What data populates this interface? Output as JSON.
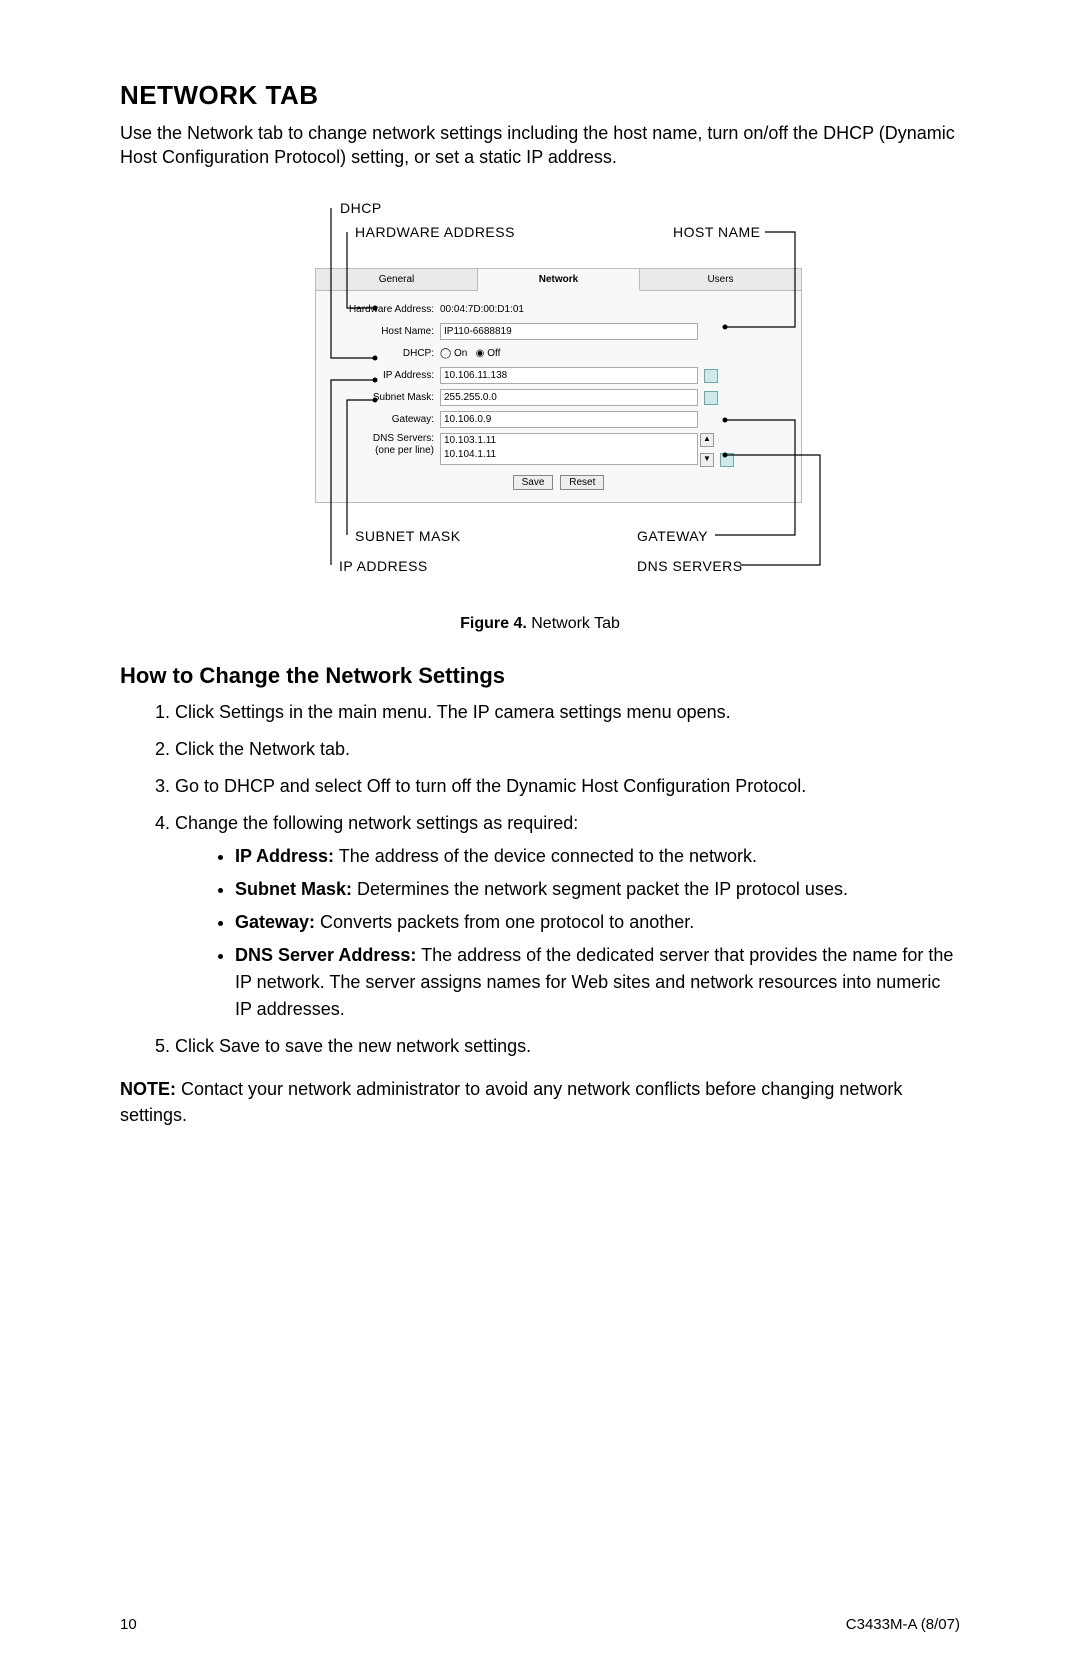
{
  "title": "NETWORK TAB",
  "intro": "Use the Network tab to change network settings including the host name, turn on/off the DHCP (Dynamic Host Configuration Protocol) setting, or set a static IP address.",
  "callouts": {
    "dhcp": "DHCP",
    "hardware_address": "HARDWARE ADDRESS",
    "host_name": "HOST NAME",
    "subnet_mask": "SUBNET MASK",
    "gateway": "GATEWAY",
    "ip_address": "IP ADDRESS",
    "dns_servers": "DNS SERVERS"
  },
  "panel": {
    "tabs": {
      "general": "General",
      "network": "Network",
      "users": "Users"
    },
    "labels": {
      "hw": "Hardware Address:",
      "host": "Host Name:",
      "dhcp": "DHCP:",
      "ip": "IP Address:",
      "subnet": "Subnet Mask:",
      "gateway": "Gateway:",
      "dns1": "DNS Servers:",
      "dns2": "(one per line)"
    },
    "values": {
      "hw": "00:04:7D:00:D1:01",
      "host": "IP110-6688819",
      "ip": "10.106.11.138",
      "subnet": "255.255.0.0",
      "gateway": "10.106.0.9",
      "dns": "10.103.1.11\n10.104.1.11"
    },
    "radio": {
      "on": "On",
      "off": "Off"
    },
    "buttons": {
      "save": "Save",
      "reset": "Reset"
    }
  },
  "figcap_bold": "Figure 4.",
  "figcap_rest": "  Network Tab",
  "subheading": "How to Change the Network Settings",
  "steps": {
    "s1": "Click Settings in the main menu. The IP camera settings menu opens.",
    "s2": "Click the Network tab.",
    "s3": "Go to DHCP and select Off to turn off the Dynamic Host Configuration Protocol.",
    "s4": "Change the following network settings as required:",
    "s5": "Click Save to save the new network settings."
  },
  "bullets": {
    "b1_head": "IP Address:",
    "b1_text": " The address of the device connected to the network.",
    "b2_head": "Subnet Mask:",
    "b2_text": " Determines the network segment packet the IP protocol uses.",
    "b3_head": "Gateway:",
    "b3_text": " Converts packets from one protocol to another.",
    "b4_head": "DNS Server Address:",
    "b4_text": " The address of the dedicated server that provides the name for the IP network. The server assigns names for Web sites and network resources into numeric IP addresses."
  },
  "note_bold": "NOTE:",
  "note_text": "  Contact your network administrator to avoid any network conflicts before changing network settings.",
  "footer": {
    "page": "10",
    "doc": "C3433M-A (8/07)"
  }
}
